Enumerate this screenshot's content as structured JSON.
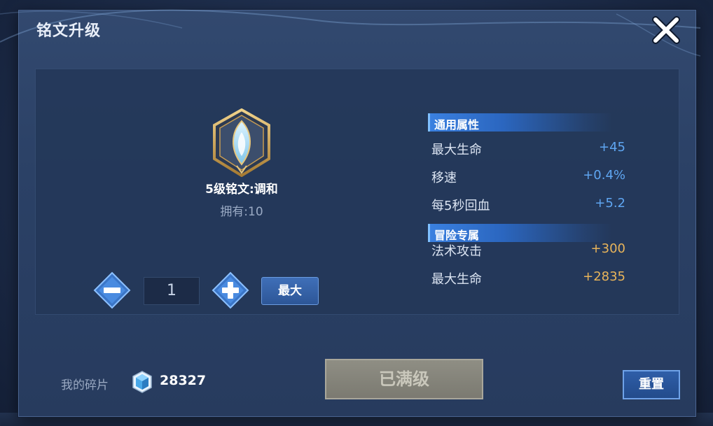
{
  "dialog": {
    "title": "铭文升级",
    "close_icon": "close-icon"
  },
  "rune": {
    "icon": "rune-crest-icon",
    "name": "5级铭文:调和",
    "owned_label": "拥有:",
    "owned_count": "10"
  },
  "quantity": {
    "minus_icon": "minus-icon",
    "value": "1",
    "plus_icon": "plus-icon",
    "max_label": "最大"
  },
  "sections": [
    {
      "title": "通用属性",
      "stats": [
        {
          "label": "最大生命",
          "value": "+45"
        },
        {
          "label": "移速",
          "value": "+0.4%"
        },
        {
          "label": "每5秒回血",
          "value": "+5.2"
        }
      ]
    },
    {
      "title": "冒险专属",
      "stats": [
        {
          "label": "法术攻击",
          "value": "+300"
        },
        {
          "label": "最大生命",
          "value": "+2835"
        }
      ]
    }
  ],
  "footer": {
    "shards_label": "我的碎片",
    "shard_icon": "crystal-shard-icon",
    "shards_count": "28327",
    "upgrade_button": "已满级",
    "reset_button": "重置"
  },
  "colors": {
    "stat_blue": "#5fa6f2",
    "stat_gold": "#e8b45a",
    "section_accent": "#3a80e0",
    "disabled_button": "#8f8e84"
  }
}
